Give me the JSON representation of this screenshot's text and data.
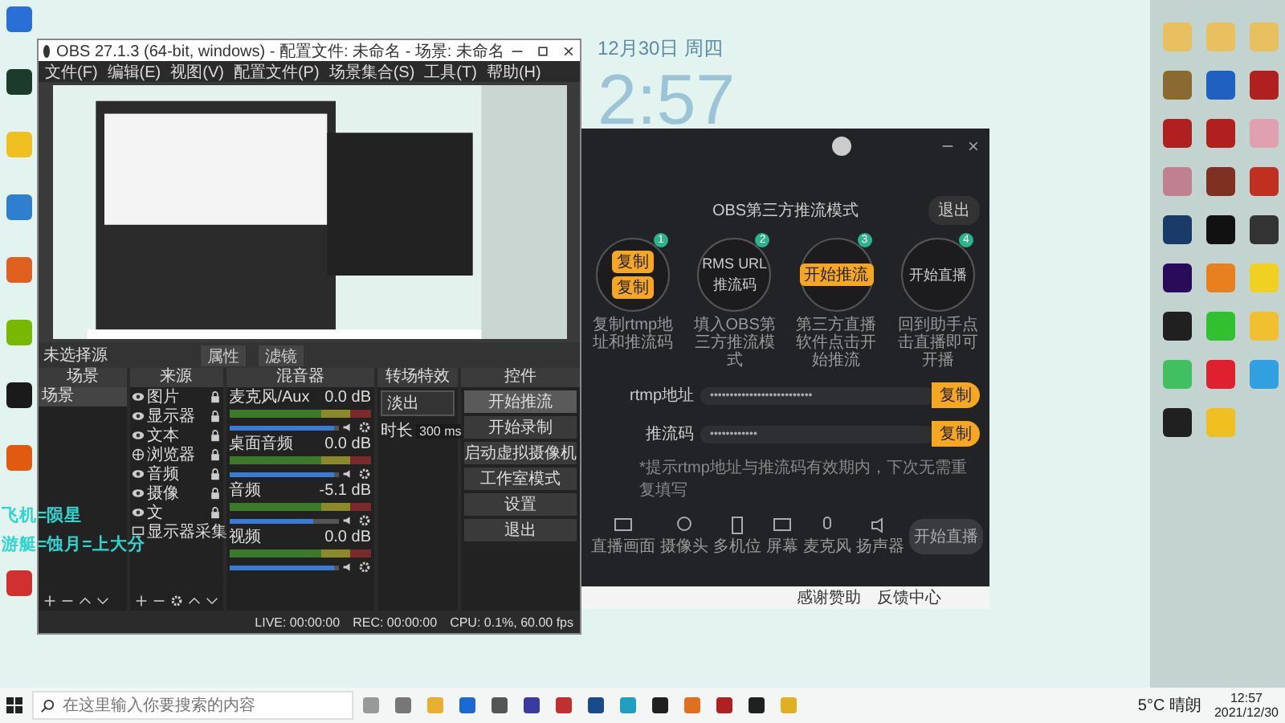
{
  "desktop": {
    "clock_date": "12月30日 周四",
    "clock_time": "2:57"
  },
  "obs": {
    "title": "OBS 27.1.3 (64-bit, windows) - 配置文件: 未命名 - 场景: 未命名",
    "menu": [
      "文件(F)",
      "编辑(E)",
      "视图(V)",
      "配置文件(P)",
      "场景集合(S)",
      "工具(T)",
      "帮助(H)"
    ],
    "source_bar": {
      "label": "未选择源",
      "buttons": [
        "属性",
        "滤镜"
      ]
    },
    "docks": [
      "场景",
      "来源",
      "混音器",
      "转场特效",
      "控件"
    ],
    "scenes": [
      {
        "label": "场景",
        "selected": true
      }
    ],
    "sources": [
      {
        "label": "图片",
        "kind": "eye"
      },
      {
        "label": "显示器",
        "kind": "eye"
      },
      {
        "label": "文本",
        "kind": "eye"
      },
      {
        "label": "浏览器",
        "kind": "globe"
      },
      {
        "label": "音频",
        "kind": "eye"
      },
      {
        "label": "摄像",
        "kind": "eye"
      },
      {
        "label": "文",
        "kind": "eye"
      },
      {
        "label": "显示器采集",
        "kind": "monitor"
      }
    ],
    "mixer": [
      {
        "name": "麦克风/Aux",
        "reading": "0.0 dB",
        "level": 0.95
      },
      {
        "name": "桌面音频",
        "reading": "0.0 dB",
        "level": 0.95
      },
      {
        "name": "音频",
        "reading": "-5.1 dB",
        "level": 0.76
      },
      {
        "name": "视频",
        "reading": "0.0 dB",
        "level": 0.95
      }
    ],
    "transition": {
      "type": "淡出",
      "duration_label": "时长",
      "duration": "300 ms"
    },
    "controls": [
      {
        "label": "开始推流",
        "selected": true
      },
      {
        "label": "开始录制",
        "selected": false
      },
      {
        "label": "启动虚拟摄像机",
        "selected": false
      },
      {
        "label": "工作室模式",
        "selected": false
      },
      {
        "label": "设置",
        "selected": false
      },
      {
        "label": "退出",
        "selected": false
      }
    ],
    "status": [
      "LIVE: 00:00:00",
      "REC: 00:00:00",
      "CPU: 0.1%, 60.00 fps"
    ]
  },
  "overlay_lines": [
    "飞机=陨星",
    "游艇=蚀月=上大分"
  ],
  "stream_app": {
    "title": "OBS第三方推流模式",
    "exit": "退出",
    "steps": [
      {
        "number": "1",
        "inner": [
          "复制",
          "复制"
        ],
        "kind": "buttons",
        "caption": "复制rtmp地址和推流码"
      },
      {
        "number": "2",
        "inner": [
          "RMS URL",
          "推流码"
        ],
        "kind": "text",
        "caption": "填入OBS第三方推流模式"
      },
      {
        "number": "3",
        "inner": [
          "开始推流"
        ],
        "kind": "buttons",
        "caption": "第三方直播软件点击开始推流"
      },
      {
        "number": "4",
        "inner": [
          "开始直播"
        ],
        "kind": "text",
        "caption": "回到助手点击直播即可开播"
      }
    ],
    "fields": [
      {
        "label": "rtmp地址",
        "value": "••••••••••••••••••••••••••",
        "button": "复制"
      },
      {
        "label": "推流码",
        "value": "••••••••••••",
        "button": "复制"
      }
    ],
    "note": "*提示rtmp地址与推流码有效期内，下次无需重复填写",
    "tools": [
      {
        "label": "直播画面",
        "kind": "screen"
      },
      {
        "label": "摄像头",
        "kind": "camera"
      },
      {
        "label": "多机位",
        "kind": "phone"
      },
      {
        "label": "屏幕",
        "kind": "screen"
      },
      {
        "label": "麦克风",
        "kind": "mic"
      },
      {
        "label": "扬声器",
        "kind": "speaker"
      }
    ],
    "start": "开始直播",
    "strip": [
      "感谢赞助",
      "反馈中心"
    ]
  },
  "taskbar": {
    "search_placeholder": "在这里输入你要搜索的内容",
    "weather": "5°C 晴朗",
    "time": "12:57",
    "date": "2021/12/30"
  }
}
